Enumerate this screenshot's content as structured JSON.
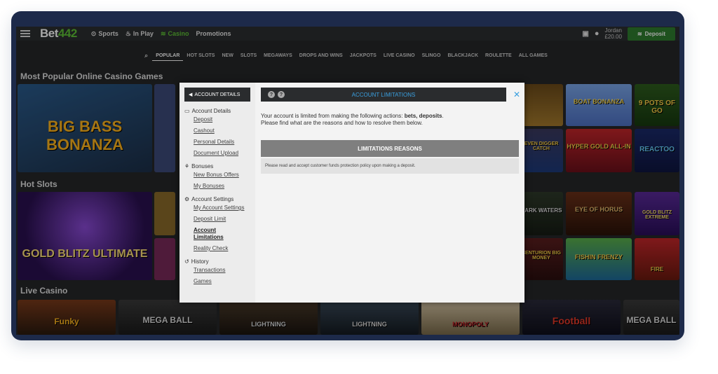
{
  "header": {
    "logo_a": "Bet",
    "logo_b": "442",
    "nav": [
      {
        "label": "Sports",
        "icon": "clock-icon"
      },
      {
        "label": "In Play",
        "icon": "flame-icon"
      },
      {
        "label": "Casino",
        "icon": "chips-icon"
      },
      {
        "label": "Promotions",
        "icon": ""
      }
    ],
    "user_name": "Jordan",
    "balance": "£20.00",
    "deposit_label": "Deposit"
  },
  "categories": [
    "POPULAR",
    "HOT SLOTS",
    "NEW",
    "SLOTS",
    "MEGAWAYS",
    "DROPS AND WINS",
    "JACKPOTS",
    "LIVE CASINO",
    "SLINGO",
    "BLACKJACK",
    "ROULETTE",
    "ALL GAMES"
  ],
  "sections": {
    "popular": "Most Popular Online Casino Games",
    "hot": "Hot Slots",
    "live": "Live Casino"
  },
  "games": {
    "big_bass": "BIG BASS BONANZA",
    "boat": "BOAT BONANZA",
    "nine_pots": "9 POTS OF GO",
    "crusher": "EVEN DIGGER CATCH",
    "hyper": "HYPER GOLD ALL-IN",
    "reactoo": "REACTOO",
    "gold_blitz": "GOLD BLITZ ULTIMATE",
    "dark_waters": "DARK WATERS",
    "horus": "EYE OF HORUS",
    "gold_extreme": "GOLD BLITZ EXTREME",
    "centurion": "CENTURION BIG MONEY",
    "fishin": "FISHIN FRENZY",
    "fire": "FIRE ",
    "funky": "Funky",
    "mega": "MEGA BALL",
    "lightning1": "LIGHTNING",
    "lightning2": "LIGHTNING",
    "monopoly": "MONOPOLY",
    "football": "Football",
    "mega2": "MEGA BALL"
  },
  "modal": {
    "back_label": "ACCOUNT DETAILS",
    "title": "ACCOUNT LIMITATIONS",
    "groups": [
      {
        "title": "Account Details",
        "icon": "id-card-icon",
        "links": [
          "Deposit",
          "Cashout",
          "Personal Details",
          "Document Upload"
        ]
      },
      {
        "title": "Bonuses",
        "icon": "gift-icon",
        "links": [
          "New Bonus Offers",
          "My Bonuses"
        ]
      },
      {
        "title": "Account Settings",
        "icon": "gear-icon",
        "links": [
          "My Account Settings",
          "Deposit Limit",
          "Account Limitations",
          "Reality Check"
        ]
      },
      {
        "title": "History",
        "icon": "history-icon",
        "links": [
          "Transactions",
          "Games"
        ]
      }
    ],
    "message_prefix": "Your account is limited from making the following actions: ",
    "message_actions": "bets, deposits",
    "message_suffix": ".",
    "message_line2": "Please find what are the reasons and how to resolve them below.",
    "limitations_header": "LIMITATIONS REASONS",
    "reason": "Please read and accept customer funds protection policy upon making a deposit."
  }
}
